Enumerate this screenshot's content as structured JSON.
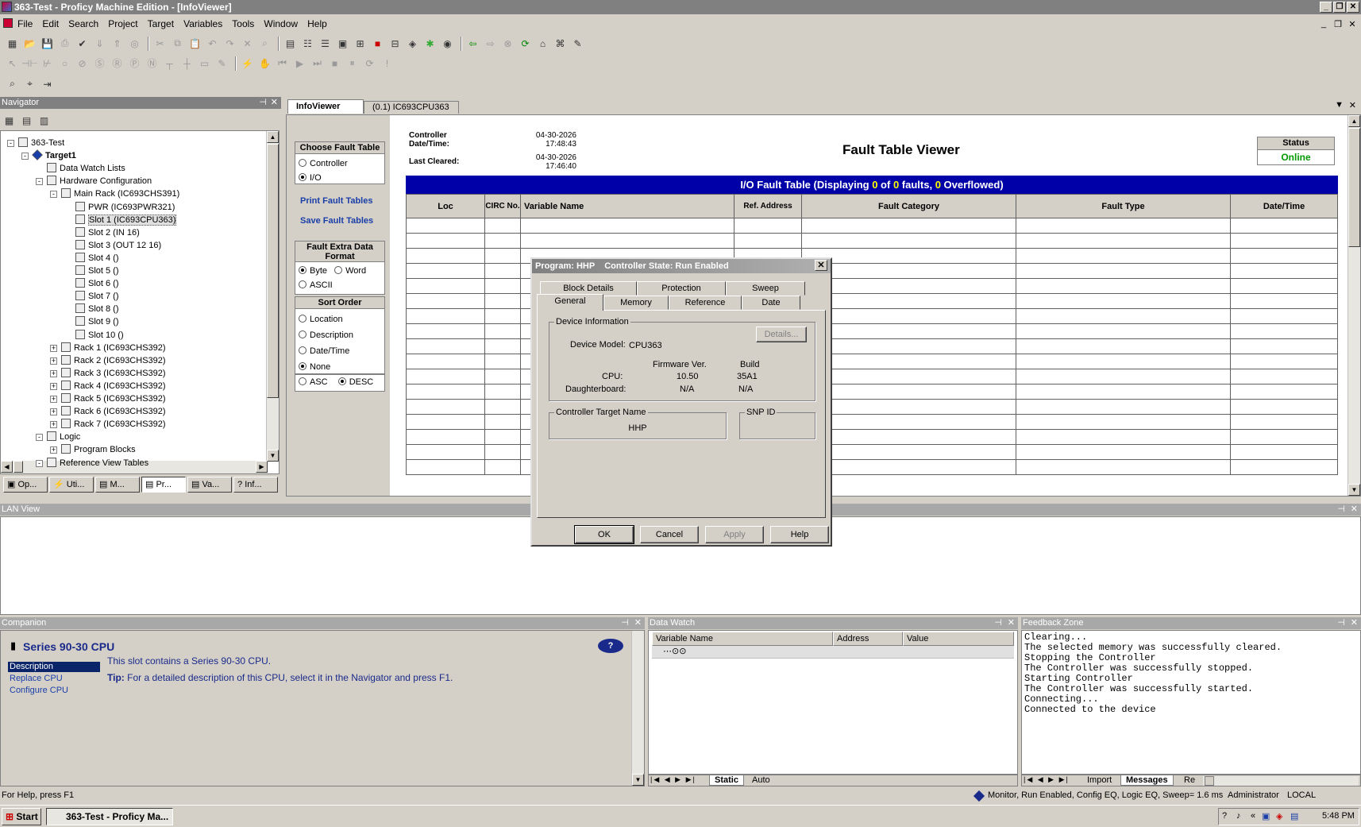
{
  "window": {
    "title": "363-Test - Proficy Machine Edition - [InfoViewer]"
  },
  "menu": [
    "File",
    "Edit",
    "Search",
    "Project",
    "Target",
    "Variables",
    "Tools",
    "Window",
    "Help"
  ],
  "navigator": {
    "title": "Navigator",
    "tree": [
      {
        "label": "363-Test",
        "level": 0,
        "expander": "-"
      },
      {
        "label": "Target1",
        "level": 1,
        "expander": "-",
        "bold": true
      },
      {
        "label": "Data Watch Lists",
        "level": 2,
        "expander": ""
      },
      {
        "label": "Hardware Configuration",
        "level": 2,
        "expander": "-"
      },
      {
        "label": "Main Rack (IC693CHS391)",
        "level": 3,
        "expander": "-"
      },
      {
        "label": "PWR (IC693PWR321)",
        "level": 4,
        "expander": ""
      },
      {
        "label": "Slot 1 (IC693CPU363)",
        "level": 4,
        "expander": "",
        "selected": true
      },
      {
        "label": "Slot 2 (IN 16)",
        "level": 4,
        "expander": ""
      },
      {
        "label": "Slot 3 (OUT 12 16)",
        "level": 4,
        "expander": ""
      },
      {
        "label": "Slot 4 ()",
        "level": 4,
        "expander": ""
      },
      {
        "label": "Slot 5 ()",
        "level": 4,
        "expander": ""
      },
      {
        "label": "Slot 6 ()",
        "level": 4,
        "expander": ""
      },
      {
        "label": "Slot 7 ()",
        "level": 4,
        "expander": ""
      },
      {
        "label": "Slot 8 ()",
        "level": 4,
        "expander": ""
      },
      {
        "label": "Slot 9 ()",
        "level": 4,
        "expander": ""
      },
      {
        "label": "Slot 10 ()",
        "level": 4,
        "expander": ""
      },
      {
        "label": "Rack 1 (IC693CHS392)",
        "level": 3,
        "expander": "+"
      },
      {
        "label": "Rack 2 (IC693CHS392)",
        "level": 3,
        "expander": "+"
      },
      {
        "label": "Rack 3 (IC693CHS392)",
        "level": 3,
        "expander": "+"
      },
      {
        "label": "Rack 4 (IC693CHS392)",
        "level": 3,
        "expander": "+"
      },
      {
        "label": "Rack 5 (IC693CHS392)",
        "level": 3,
        "expander": "+"
      },
      {
        "label": "Rack 6 (IC693CHS392)",
        "level": 3,
        "expander": "+"
      },
      {
        "label": "Rack 7 (IC693CHS392)",
        "level": 3,
        "expander": "+"
      },
      {
        "label": "Logic",
        "level": 2,
        "expander": "-"
      },
      {
        "label": "Program Blocks",
        "level": 3,
        "expander": "+"
      },
      {
        "label": "Reference View Tables",
        "level": 2,
        "expander": "-"
      }
    ],
    "bottom_tabs": [
      "Op...",
      "Uti...",
      "M...",
      "Pr...",
      "Va...",
      "Inf..."
    ]
  },
  "editor_tabs": [
    "InfoViewer",
    "(0.1) IC693CPU363"
  ],
  "fault_viewer": {
    "controller_datetime_label": "Controller Date/Time:",
    "controller_datetime": "04-30-2026 17:48:43",
    "last_cleared_label": "Last Cleared:",
    "last_cleared": "04-30-2026 17:46:40",
    "heading": "Fault Table Viewer",
    "status_label": "Status",
    "status_value": "Online",
    "choose_title": "Choose Fault Table",
    "choose_options": [
      "Controller",
      "I/O"
    ],
    "print_link": "Print Fault Tables",
    "save_link": "Save Fault Tables",
    "format_title": "Fault Extra Data Format",
    "format_options": [
      "Byte",
      "Word",
      "ASCII"
    ],
    "sort_title": "Sort Order",
    "sort_options": [
      "Location",
      "Description",
      "Date/Time",
      "None"
    ],
    "order_options": [
      "ASC",
      "DESC"
    ],
    "table_banner_prefix": "I/O Fault Table (Displaying ",
    "table_banner_shown": "0",
    "table_banner_of": " of ",
    "table_banner_total": "0",
    "table_banner_mid": " faults, ",
    "table_banner_overflow": "0",
    "table_banner_suffix": " Overflowed)",
    "columns": [
      "Loc",
      "CIRC No.",
      "Variable Name",
      "Ref. Address",
      "Fault Category",
      "Fault Type",
      "Date/Time"
    ]
  },
  "dialog": {
    "title": "Program: HHP    Controller State: Run Enabled",
    "tabs_row1": [
      "Block Details",
      "Protection",
      "Sweep"
    ],
    "tabs_row2": [
      "General",
      "Memory",
      "Reference",
      "Date"
    ],
    "device_info_label": "Device Information",
    "details_button": "Details...",
    "device_model_label": "Device Model:",
    "device_model": "CPU363",
    "firmware_header": "Firmware Ver.",
    "build_header": "Build",
    "cpu_label": "CPU:",
    "cpu_firmware": "10.50",
    "cpu_build": "35A1",
    "daughter_label": "Daughterboard:",
    "daughter_firmware": "N/A",
    "daughter_build": "N/A",
    "target_name_label": "Controller Target Name",
    "target_name": "HHP",
    "snp_label": "SNP ID",
    "snp_value": "",
    "buttons": [
      "OK",
      "Cancel",
      "Apply",
      "Help"
    ]
  },
  "lan_view": {
    "title": "LAN View"
  },
  "companion": {
    "title": "Companion",
    "heading": "Series 90-30 CPU",
    "links": [
      "Description",
      "Replace CPU",
      "Configure CPU"
    ],
    "text": "This slot contains a Series 90-30 CPU.",
    "tip_label": "Tip:",
    "tip": "For a detailed description of this CPU, select it in the Navigator and press F1."
  },
  "data_watch": {
    "title": "Data Watch",
    "columns": [
      "Variable Name",
      "Address",
      "Value"
    ],
    "tabs": [
      "Static",
      "Auto"
    ]
  },
  "feedback": {
    "title": "Feedback Zone",
    "lines": [
      "Clearing...",
      "The selected memory was successfully cleared.",
      "Stopping the Controller",
      "The Controller was successfully stopped.",
      "Starting Controller",
      "The Controller was successfully started.",
      "Connecting...",
      "Connected to the device"
    ],
    "tabs": [
      "Import",
      "Messages",
      "Re"
    ]
  },
  "statusbar": {
    "help": "For Help, press F1",
    "state": "Monitor, Run Enabled, Config EQ, Logic EQ, Sweep=  1.6 ms",
    "user": "Administrator",
    "location": "LOCAL"
  },
  "taskbar": {
    "start": "Start",
    "task": "363-Test - Proficy Ma...",
    "clock": "5:48 PM"
  }
}
